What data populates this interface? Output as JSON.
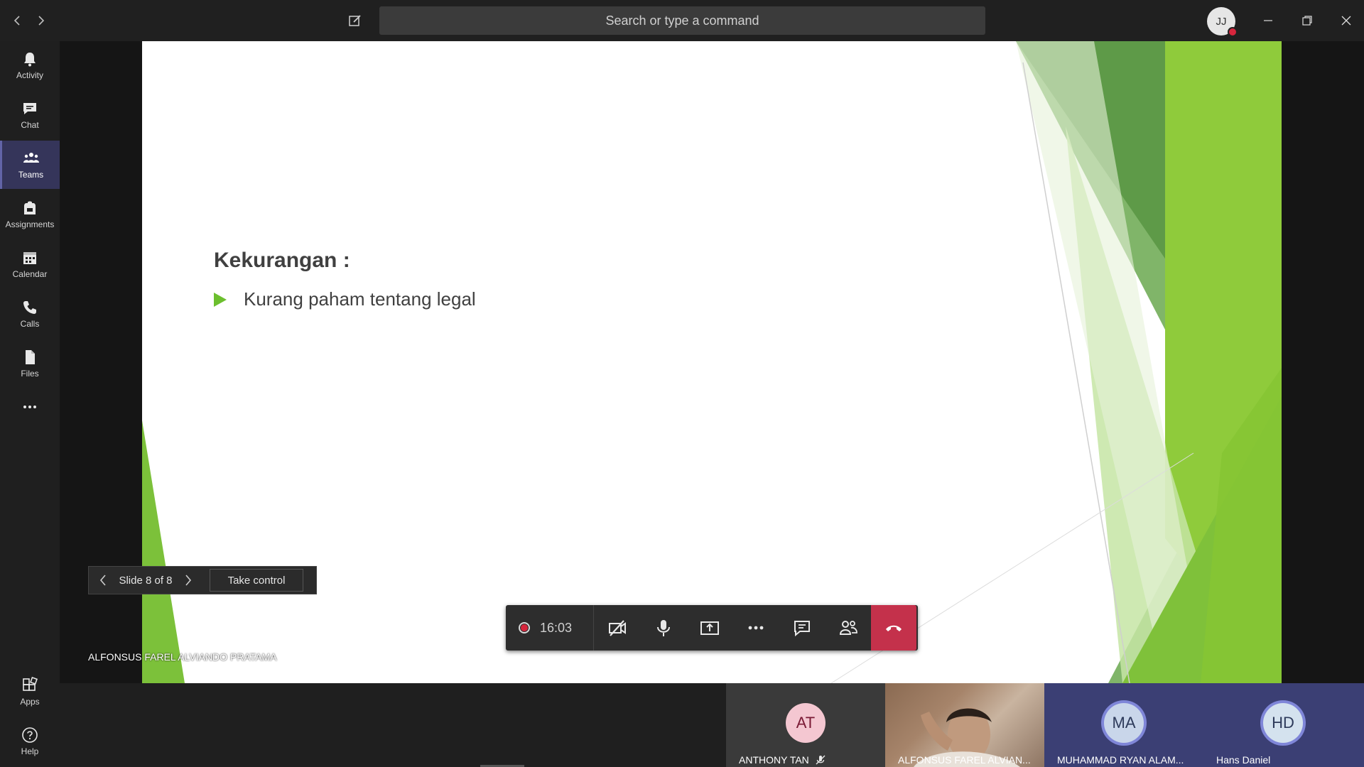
{
  "titlebar": {
    "search_placeholder": "Search or type a command",
    "avatar_initials": "JJ"
  },
  "rail": {
    "items": [
      {
        "label": "Activity",
        "icon": "bell-icon"
      },
      {
        "label": "Chat",
        "icon": "chat-icon"
      },
      {
        "label": "Teams",
        "icon": "teams-icon",
        "active": true
      },
      {
        "label": "Assignments",
        "icon": "backpack-icon"
      },
      {
        "label": "Calendar",
        "icon": "calendar-icon"
      },
      {
        "label": "Calls",
        "icon": "phone-icon"
      },
      {
        "label": "Files",
        "icon": "file-icon"
      }
    ],
    "apps_label": "Apps",
    "help_label": "Help"
  },
  "slide": {
    "heading": "Kekurangan :",
    "bullet": "Kurang paham tentang legal"
  },
  "slide_control": {
    "label": "Slide 8 of 8",
    "take_control": "Take control"
  },
  "presenter": {
    "name": "ALFONSUS FAREL ALVIANDO PRATAMA"
  },
  "call_bar": {
    "elapsed": "16:03"
  },
  "participants": [
    {
      "initials": "AT",
      "name": "ANTHONY TAN",
      "muted": true
    },
    {
      "initials": "",
      "name": "ALFONSUS FAREL ALVIAN...",
      "video": true
    },
    {
      "initials": "MA",
      "name": "MUHAMMAD RYAN ALAM..."
    },
    {
      "initials": "HD",
      "name": "Hans Daniel"
    }
  ],
  "colors": {
    "accent": "#6264a7",
    "hangup": "#c4314b",
    "slide_green": "#6cbf2e",
    "record": "#d7263d"
  }
}
